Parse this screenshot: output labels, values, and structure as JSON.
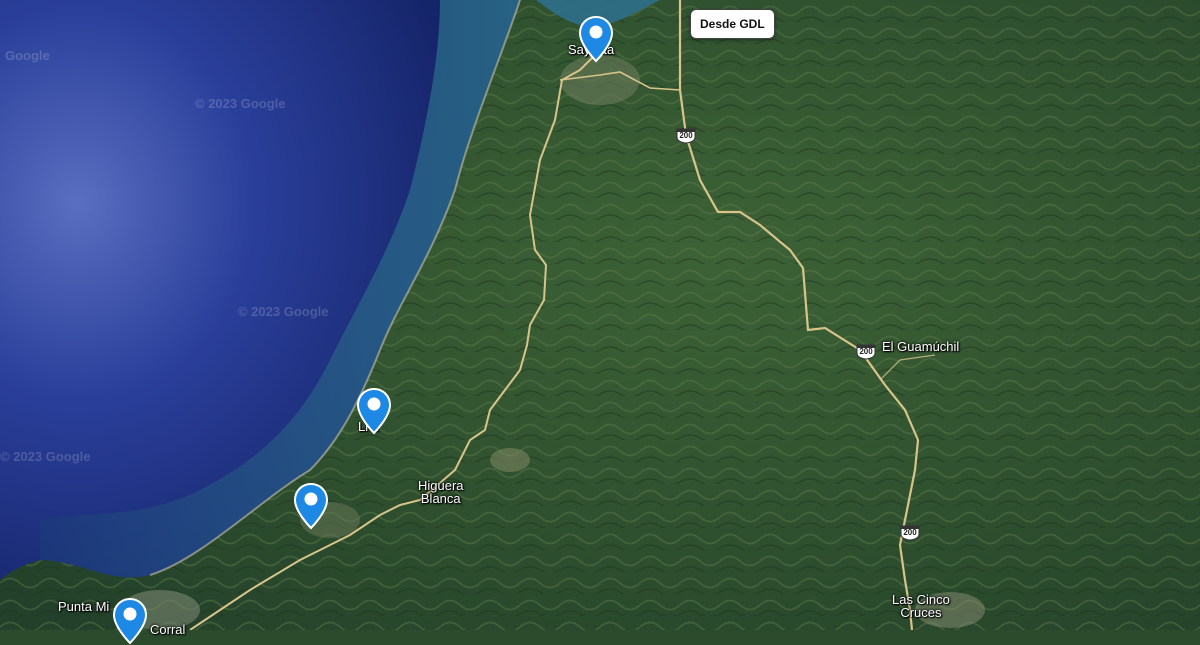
{
  "map": {
    "type": "satellite",
    "colors": {
      "ocean_deep": "#1f2f7a",
      "ocean_mid": "#27419a",
      "shallow": "#2d6d88",
      "land": "#2f5130",
      "land_light": "#4a6b3e",
      "road": "#d7c48a",
      "pin": "#1e88e5"
    }
  },
  "button": {
    "label": "Desde GDL"
  },
  "places": {
    "sayulita": "Sayulita",
    "lo_de_marcos": "Lo de Marcos",
    "higuera_blanca": "Higuera Blanca",
    "el_guamuchil": "El Guamúchil",
    "punta_mita": "Punta Mita",
    "corral": "Corral",
    "las_cinco_cruces_1": "Las Cinco",
    "las_cinco_cruces_2": "Cruces",
    "lo_partial": "Li   u"
  },
  "route_shields": [
    "200",
    "200",
    "200"
  ],
  "watermarks": [
    "Google",
    "© 2023 Google",
    "© 2023 Google",
    "© 2023 Google"
  ],
  "pins": [
    {
      "name": "pin-sayulita",
      "icon": "map-pin-icon"
    },
    {
      "name": "pin-beach",
      "icon": "map-pin-icon"
    },
    {
      "name": "pin-coast",
      "icon": "map-pin-icon"
    },
    {
      "name": "pin-punta-mita",
      "icon": "map-pin-icon"
    }
  ]
}
